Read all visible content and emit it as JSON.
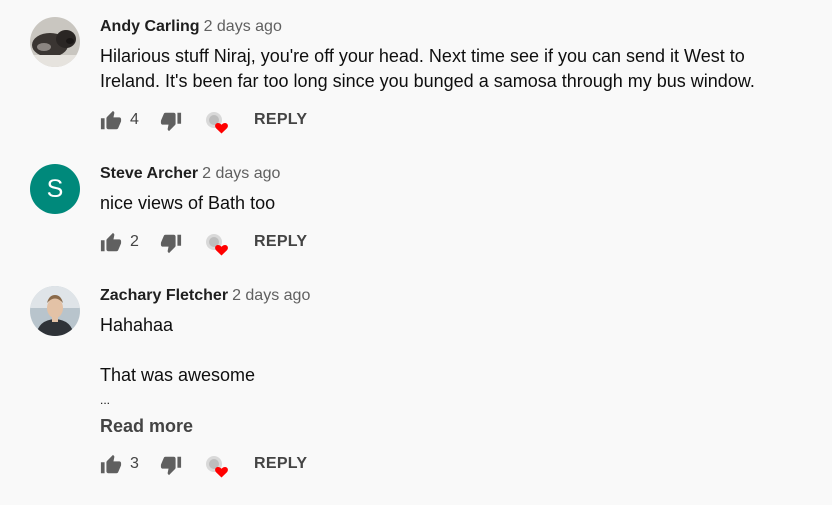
{
  "comments": [
    {
      "author": "Andy Carling",
      "time": "2 days ago",
      "lines": [
        "Hilarious stuff Niraj, you're off your head. Next time see if you can send it West to",
        "Ireland. It's been far too long since you bunged a samosa through my bus window."
      ],
      "likes": "4",
      "reply_label": "REPLY",
      "avatar_icon": "dog-photo-avatar"
    },
    {
      "author": "Steve Archer",
      "time": "2 days ago",
      "lines": [
        "nice views of Bath too"
      ],
      "likes": "2",
      "reply_label": "REPLY",
      "avatar_letter": "S",
      "avatar_color": "#00897b"
    },
    {
      "author": "Zachary Fletcher",
      "time": "2 days ago",
      "lines": [
        "Hahahaa",
        "",
        "That was awesome",
        "..."
      ],
      "read_more": "Read more",
      "likes": "3",
      "reply_label": "REPLY",
      "avatar_icon": "person-photo-avatar"
    }
  ],
  "icons": {
    "like": "thumb-up-icon",
    "dislike": "thumb-down-icon",
    "creator_heart": "creator-heart-icon",
    "heart_color": "#ff0000"
  }
}
